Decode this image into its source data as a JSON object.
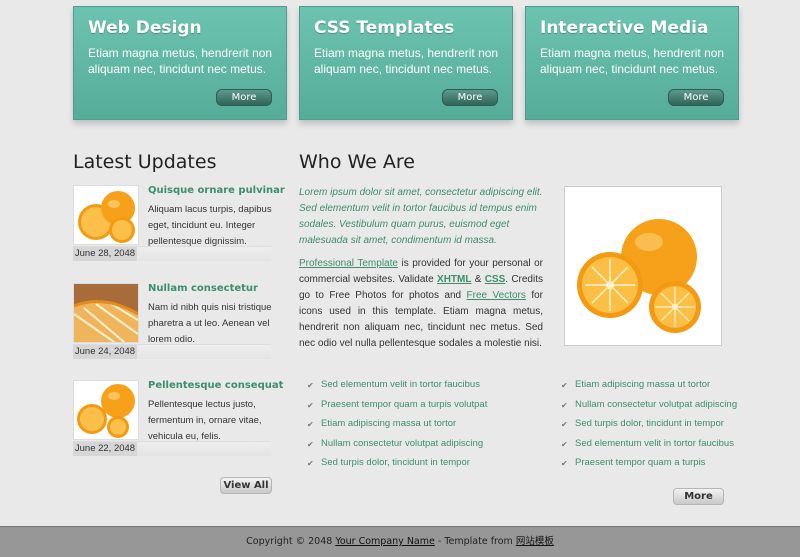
{
  "feature_boxes": [
    {
      "title": "Web Design",
      "text": "Etiam magna metus, hendrerit non aliquam nec, tincidunt nec metus.",
      "button": "More"
    },
    {
      "title": "CSS Templates",
      "text": "Etiam magna metus, hendrerit non aliquam nec, tincidunt nec metus.",
      "button": "More"
    },
    {
      "title": "Interactive Media",
      "text": "Etiam magna metus, hendrerit non aliquam nec, tincidunt nec metus.",
      "button": "More"
    }
  ],
  "latest": {
    "heading": "Latest Updates",
    "items": [
      {
        "title": "Quisque ornare pulvinar",
        "text": "Aliquam lacus turpis, dapibus eget, tincidunt eu. Integer pellentesque dignissim.",
        "date": "June 28, 2048",
        "image": "orange-halves-icon"
      },
      {
        "title": "Nullam consectetur",
        "text": "Nam id nibh quis nisi tristique pharetra a ut leo. Aenean vel lorem odio.",
        "date": "June 24, 2048",
        "image": "orange-slice-icon"
      },
      {
        "title": "Pellentesque consequat",
        "text": "Pellentesque lectus justo, fermentum in, ornare vitae, vehicula eu, felis.",
        "date": "June 22, 2048",
        "image": "orange-halves-icon"
      }
    ],
    "view_all": "View All"
  },
  "who": {
    "heading": "Who We Are",
    "intro": "Lorem ipsum dolor sit amet, consectetur adipiscing elit. Sed elementum velit in tortor faucibus id tempus enim sodales. Vestibulum quam purus, euismod eget malesuada sit amet, condimentum id massa.",
    "link_template": "Professional Template",
    "text1": " is provided for your personal or commercial websites. Validate ",
    "link_xhtml": "XHTML",
    "amp": " & ",
    "link_css": "CSS",
    "text2": ". Credits go to Free Photos for photos and ",
    "link_vectors": "Free Vectors",
    "text3": " for icons used in this template. Etiam magna metus, hendrerit non aliquam nec, tincidunt nec metus. Sed nec odio vel nulla pellentesque sodales a molestie nisi.",
    "list_left": [
      "Sed elementum velit in tortor faucibus",
      "Praesent tempor quam a turpis volutpat",
      "Etiam adipiscing massa ut tortor",
      "Nullam consectetur volutpat adipiscing",
      "Sed turpis dolor, tincidunt in tempor"
    ],
    "list_right": [
      "Etiam adipiscing massa ut tortor",
      "Nullam consectetur volutpat adipiscing",
      "Sed turpis dolor, tincidunt in tempor",
      "Sed elementum velit in tortor faucibus",
      "Praesent tempor quam a turpis"
    ],
    "more": "More"
  },
  "footer": {
    "prefix": "Copyright © 2048 ",
    "company": "Your Company Name",
    "middle": " - Template from ",
    "site": "网站模板"
  },
  "colors": {
    "accent": "#5bb39f",
    "link": "#3b8f6a",
    "background": "#eae9ea",
    "footer": "#979797"
  }
}
